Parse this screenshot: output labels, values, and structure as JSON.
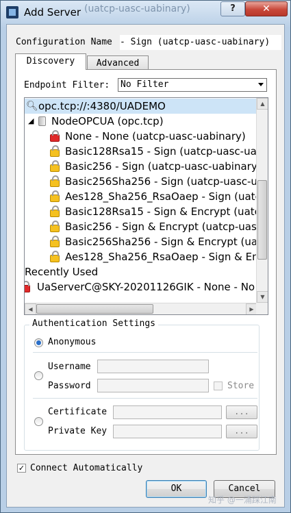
{
  "window": {
    "title": "Add Server",
    "help_label": "?",
    "close_label": "✕",
    "background_title_fragment": "(uatcp-uasc-uabinary)"
  },
  "config": {
    "label": "Configuration Name",
    "value": "- Sign (uatcp-uasc-uabinary)"
  },
  "tabs": [
    {
      "label": "Discovery",
      "active": true
    },
    {
      "label": "Advanced",
      "active": false
    }
  ],
  "endpoint_filter": {
    "label": "Endpoint Filter:",
    "value": "No Filter"
  },
  "tree": {
    "root": "opc.tcp://:4380/UADEMO",
    "server_node": "NodeOPCUA (opc.tcp)",
    "endpoints": [
      {
        "label": "None - None (uatcp-uasc-uabinary)",
        "lock": "red"
      },
      {
        "label": "Basic128Rsa15 - Sign (uatcp-uasc-uab",
        "lock": "yellow"
      },
      {
        "label": "Basic256 - Sign (uatcp-uasc-uabinary)",
        "lock": "yellow"
      },
      {
        "label": "Basic256Sha256 - Sign (uatcp-uasc-ua",
        "lock": "yellow"
      },
      {
        "label": "Aes128_Sha256_RsaOaep - Sign (uatcp",
        "lock": "yellow"
      },
      {
        "label": "Basic128Rsa15 - Sign & Encrypt (uatcp",
        "lock": "yellow"
      },
      {
        "label": "Basic256 - Sign & Encrypt (uatcp-uasc",
        "lock": "yellow"
      },
      {
        "label": "Basic256Sha256 - Sign & Encrypt (uat",
        "lock": "yellow"
      },
      {
        "label": "Aes128_Sha256_RsaOaep - Sign & Enc",
        "lock": "yellow"
      }
    ],
    "recently_used_label": "Recently Used",
    "recent": [
      {
        "label": "UaServerC@SKY-20201126GIK - None - No"
      }
    ]
  },
  "auth": {
    "legend": "Authentication Settings",
    "anonymous_label": "Anonymous",
    "username_label": "Username",
    "password_label": "Password",
    "store_label": "Store",
    "certificate_label": "Certificate",
    "private_key_label": "Private Key",
    "browse_label": "...",
    "selected": "anonymous"
  },
  "connect_automatically": {
    "label": "Connect Automatically",
    "checked": true
  },
  "buttons": {
    "ok": "OK",
    "cancel": "Cancel"
  },
  "watermark": "知乎 @一涌踩江南",
  "colors": {
    "title_bar": "#c5d6e8",
    "selection": "#cde4f7",
    "close_button": "#c9483a"
  },
  "icons": {
    "search": "magnifier-icon",
    "server": "server-icon",
    "lock_closed": "lock-icon"
  }
}
